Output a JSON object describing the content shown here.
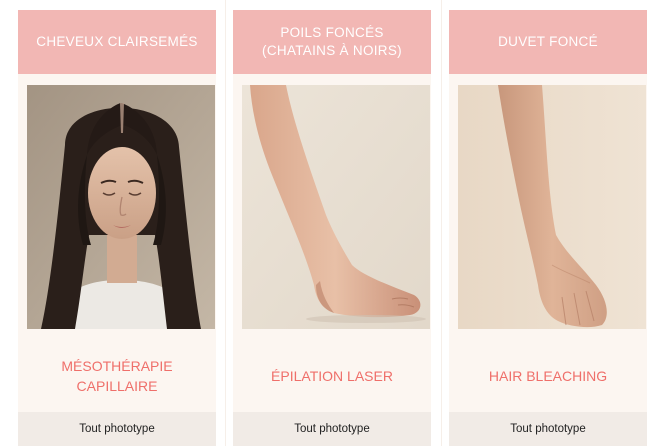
{
  "columns": [
    {
      "header": "CHEVEUX CLAIRSEMÉS",
      "photo": "woman-thinning-hair-photo",
      "treatment": "MÉSOTHÉRAPIE\nCAPILLAIRE",
      "footer": "Tout phototype"
    },
    {
      "header": "POILS FONCÉS\n(CHATAINS À NOIRS)",
      "photo": "bare-leg-photo",
      "treatment": "ÉPILATION LASER",
      "footer": "Tout phototype"
    },
    {
      "header": "DUVET FONCÉ",
      "photo": "bare-arm-photo",
      "treatment": "HAIR BLEACHING",
      "footer": "Tout phototype"
    }
  ],
  "colors": {
    "header_bg": "#f2b7b4",
    "treatment_text": "#ef6f6a",
    "body_bg": "#fcf6f1",
    "footer_bg": "#f1ebe6"
  }
}
